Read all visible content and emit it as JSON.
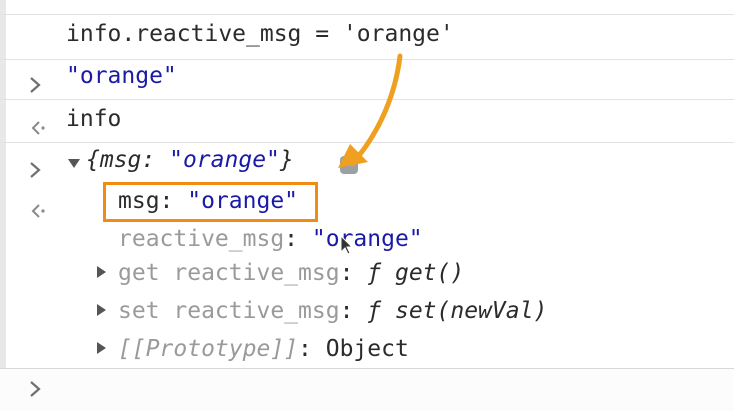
{
  "console": {
    "cmd1_text": "info.reactive_msg = 'orange'",
    "result1_text": "\"orange\"",
    "cmd2_text": "info",
    "object_summary": {
      "open_brace": "{",
      "key": "msg",
      "colon": ": ",
      "value": "\"orange\"",
      "close_brace": "}"
    },
    "props": [
      {
        "key": "msg",
        "sep": ": ",
        "value": "\"orange\""
      },
      {
        "key": "reactive_msg",
        "sep": ": ",
        "value": "\"orange\""
      },
      {
        "key": "get reactive_msg",
        "sep": ": ",
        "f": "ƒ",
        "value": " get()"
      },
      {
        "key": "set reactive_msg",
        "sep": ": ",
        "f": "ƒ",
        "value": " set(newVal)"
      },
      {
        "key": "[[Prototype]]",
        "sep": ": ",
        "value": "Object"
      }
    ]
  },
  "colors": {
    "highlight": "#f08c16",
    "arrow": "#f0a020",
    "string": "#1a1aa6"
  },
  "icons": {
    "input_prompt": "chevron-right-icon",
    "output_prompt": "return-arrow-icon",
    "expand": "triangle-icon"
  }
}
